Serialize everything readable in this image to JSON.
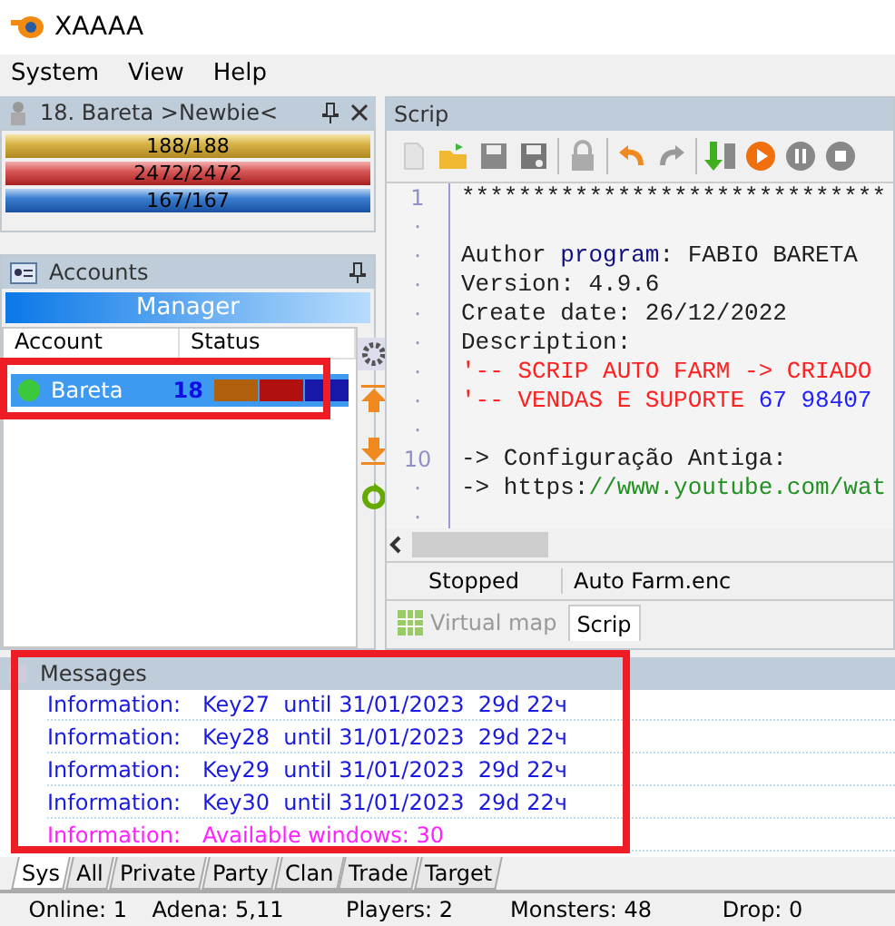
{
  "window": {
    "title": "XAAAA"
  },
  "menu": [
    "System",
    "View",
    "Help"
  ],
  "character": {
    "title": "18. Bareta  >Newbie<",
    "bars": [
      {
        "kind": "cp",
        "text": "188/188",
        "level": 1
      },
      {
        "kind": "hp",
        "text": "2472/2472",
        "level": 1
      },
      {
        "kind": "mp",
        "text": "167/167",
        "level": 1
      }
    ]
  },
  "accounts": {
    "title": "Accounts",
    "manager": "Manager",
    "columns": [
      "Account",
      "Status"
    ],
    "rows": [
      {
        "name": "Bareta",
        "level": "18",
        "color": "#3cc83c",
        "selected": true
      }
    ]
  },
  "script": {
    "title": "Scrip",
    "lines": [
      {
        "gutter": "1",
        "segments": [
          {
            "kind": "plain",
            "text": "******************************"
          }
        ]
      },
      {
        "gutter": "·"
      },
      {
        "gutter": "·",
        "segments": [
          {
            "kind": "plain",
            "text": "Author "
          },
          {
            "kind": "keyword",
            "text": "program"
          },
          {
            "kind": "plain",
            "text": ": FABIO BARETA"
          }
        ]
      },
      {
        "gutter": "·",
        "segments": [
          {
            "kind": "plain",
            "text": "Version: 4.9.6"
          }
        ]
      },
      {
        "gutter": "·",
        "segments": [
          {
            "kind": "plain",
            "text": "Create date: 26/12/2022"
          }
        ]
      },
      {
        "gutter": "·",
        "segments": [
          {
            "kind": "plain",
            "text": "Description:"
          }
        ]
      },
      {
        "gutter": "·",
        "segments": [
          {
            "kind": "comment",
            "text": "'-- SCRIP AUTO FARM -> CRIADO"
          }
        ]
      },
      {
        "gutter": "·",
        "segments": [
          {
            "kind": "comment",
            "text": "'-- VENDAS E SUPORTE "
          },
          {
            "kind": "number",
            "text": "67 98407"
          }
        ]
      },
      {
        "gutter": "·"
      },
      {
        "gutter": "10",
        "segments": [
          {
            "kind": "plain",
            "text": "-> Configuração Antiga:"
          }
        ]
      },
      {
        "gutter": "·",
        "segments": [
          {
            "kind": "plain",
            "text": "-> https:"
          },
          {
            "kind": "link",
            "text": "//www.youtube.com/wat"
          }
        ]
      },
      {
        "gutter": "·"
      }
    ],
    "status": "Stopped",
    "file": "Auto Farm.enc",
    "tabs": [
      {
        "label": "Virtual map",
        "selected": false
      },
      {
        "label": "Scrip",
        "selected": true
      }
    ]
  },
  "messages": {
    "title": "Messages",
    "rows": [
      {
        "kind": "info",
        "label": "Information:",
        "text": "Key27  until 31/01/2023  29d 22ч"
      },
      {
        "kind": "info",
        "label": "Information:",
        "text": "Key28  until 31/01/2023  29d 22ч"
      },
      {
        "kind": "info",
        "label": "Information:",
        "text": "Key29  until 31/01/2023  29d 22ч"
      },
      {
        "kind": "info",
        "label": "Information:",
        "text": "Key30  until 31/01/2023  29d 22ч"
      },
      {
        "kind": "notice",
        "label": "Information:",
        "text": "Available windows: 30"
      }
    ],
    "tabs": [
      {
        "label": "Sys",
        "selected": true
      },
      {
        "label": "All",
        "selected": false
      },
      {
        "label": "Private",
        "selected": false
      },
      {
        "label": "Party",
        "selected": false
      },
      {
        "label": "Clan",
        "selected": false
      },
      {
        "label": "Trade",
        "selected": false
      },
      {
        "label": "Target",
        "selected": false
      }
    ]
  },
  "status_bar": [
    "Online: 1",
    "Adena: 5,11",
    "Players: 2",
    "Monsters: 48",
    "Drop: 0"
  ]
}
